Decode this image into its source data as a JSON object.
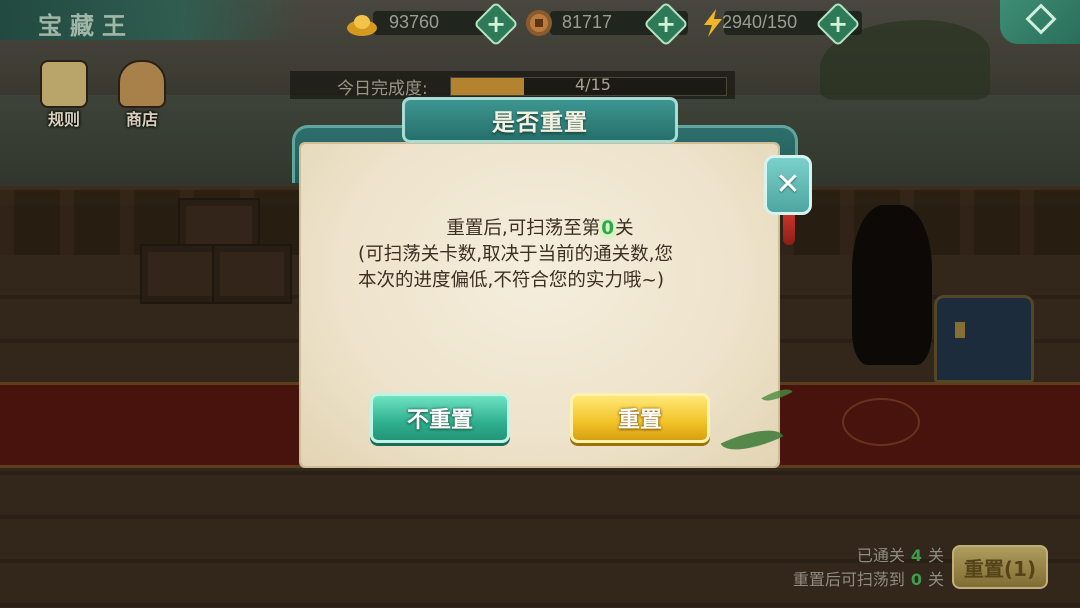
{
  "hud": {
    "title": "宝藏王",
    "gold": "93760",
    "coins": "81717",
    "energy": "2940/150"
  },
  "daily": {
    "label": "今日完成度:",
    "progress_text": "4/15",
    "progress_fraction": 0.2667
  },
  "side_buttons": [
    {
      "label": "规则",
      "icon": "scroll-icon"
    },
    {
      "label": "商店",
      "icon": "basket-icon"
    }
  ],
  "dialog": {
    "title": "是否重置",
    "line1_pre": "重置后,可扫荡至第",
    "line1_level": "0",
    "line1_post": "关",
    "line2": "(可扫荡关卡数,取决于当前的通关数,您",
    "line3": "本次的进度偏低,不符合您的实力哦~)",
    "cancel_label": "不重置",
    "confirm_label": "重置"
  },
  "status": {
    "cleared_label": "已通关",
    "cleared_value": "4",
    "cleared_unit": "关",
    "sweep_label": "重置后可扫荡到",
    "sweep_value": "0",
    "sweep_unit": "关",
    "reset_button": "重置(1)"
  },
  "colors": {
    "accent_teal": "#2fb08e",
    "accent_gold": "#f2c328",
    "level_green": "#2fa74a"
  }
}
